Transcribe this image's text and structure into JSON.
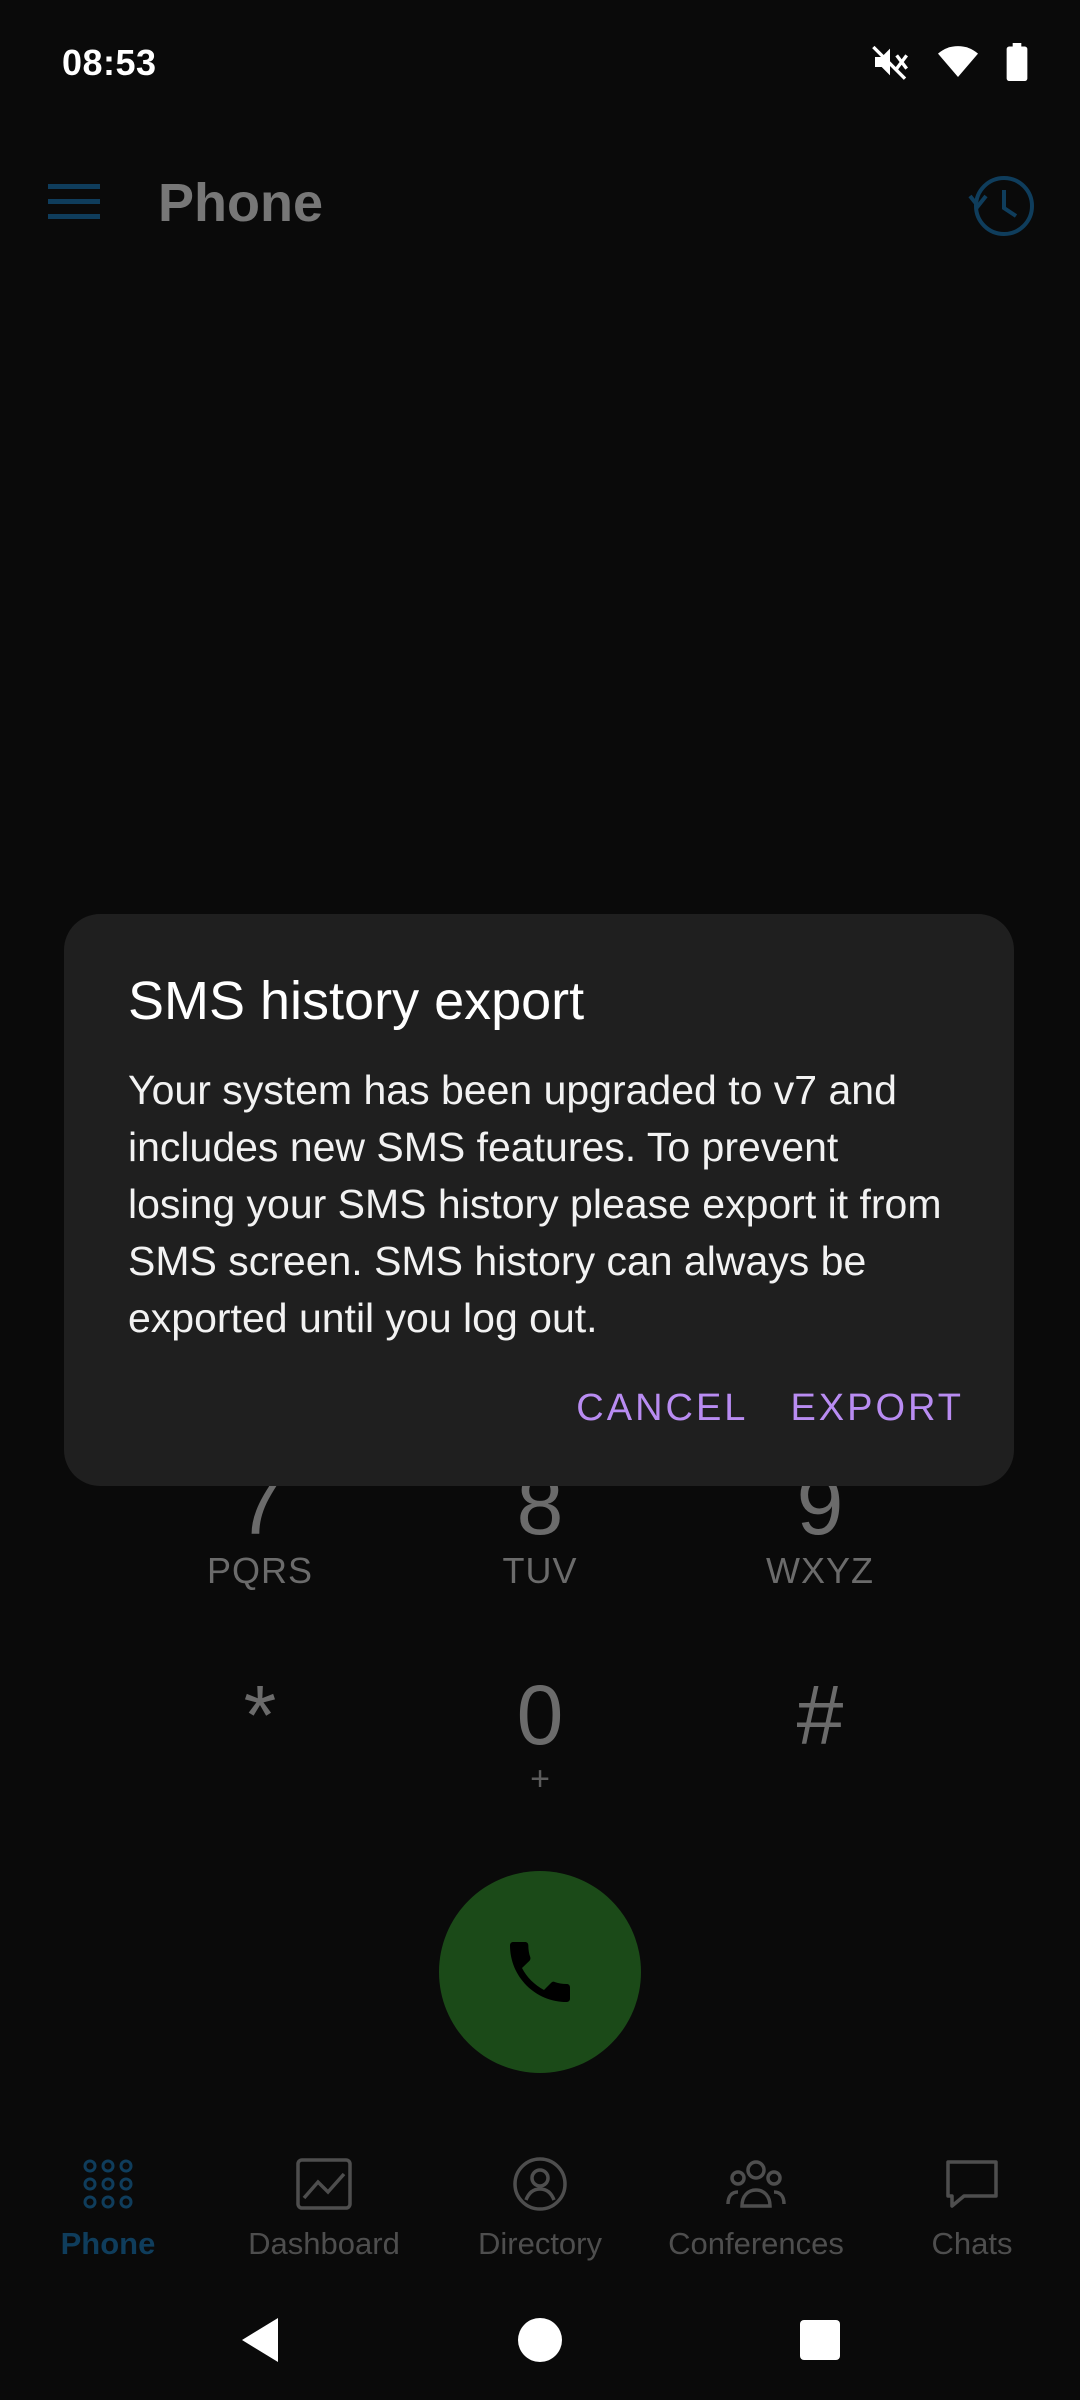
{
  "status_bar": {
    "time": "08:53",
    "icons": [
      "volume-muted-icon",
      "wifi-icon",
      "battery-icon"
    ]
  },
  "app_bar": {
    "title": "Phone",
    "menu_icon": "hamburger-menu-icon",
    "history_icon": "call-history-icon"
  },
  "dialpad": {
    "keys": [
      {
        "digit": "7",
        "letters": "PQRS"
      },
      {
        "digit": "8",
        "letters": "TUV"
      },
      {
        "digit": "9",
        "letters": "WXYZ"
      },
      {
        "digit": "*",
        "letters": ""
      },
      {
        "digit": "0",
        "letters": "+"
      },
      {
        "digit": "#",
        "letters": ""
      }
    ],
    "call_icon": "phone-call-icon"
  },
  "dialog": {
    "title": "SMS history export",
    "body": "Your system has been upgraded to v7 and includes new SMS features. To prevent losing your SMS history please export it from SMS screen. SMS history can always be exported until you log out.",
    "cancel_label": "CANCEL",
    "export_label": "EXPORT"
  },
  "bottom_nav": {
    "items": [
      {
        "label": "Phone",
        "icon": "dialpad-icon",
        "active": true
      },
      {
        "label": "Dashboard",
        "icon": "dashboard-icon",
        "active": false
      },
      {
        "label": "Directory",
        "icon": "directory-icon",
        "active": false
      },
      {
        "label": "Conferences",
        "icon": "conferences-icon",
        "active": false
      },
      {
        "label": "Chats",
        "icon": "chats-icon",
        "active": false
      }
    ]
  },
  "system_nav": {
    "icons": [
      "back-icon",
      "home-icon",
      "recents-icon"
    ]
  },
  "colors": {
    "background": "#0a0a0a",
    "dialog": "#1f1f1f",
    "dialog_button": "#b98cf2",
    "accent_dim": "#0f3d5c",
    "call_button": "#1b4a18"
  }
}
